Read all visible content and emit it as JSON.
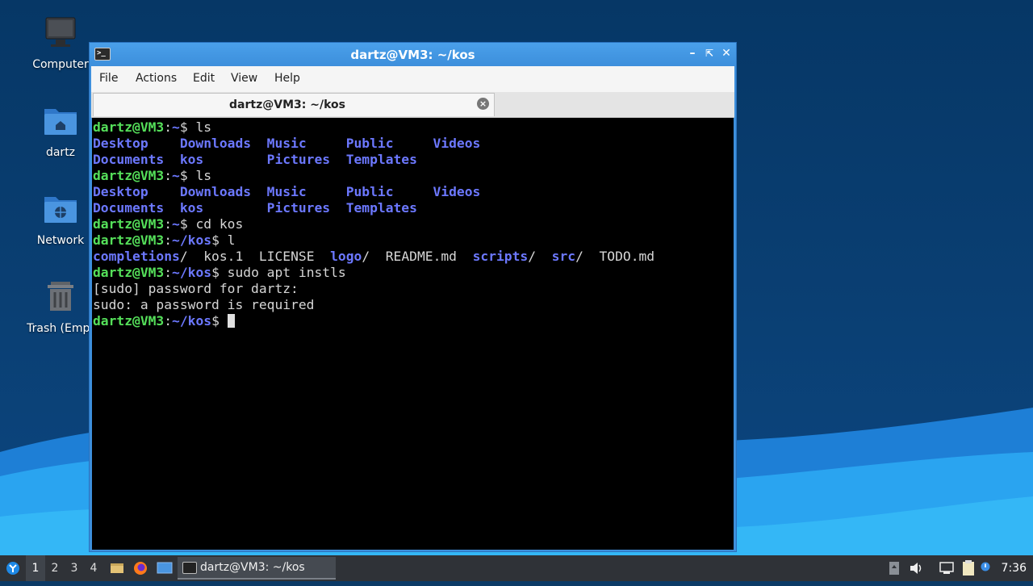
{
  "desktop": {
    "icons": [
      {
        "label": "Computer",
        "icon": "computer-icon"
      },
      {
        "label": "dartz",
        "icon": "home-folder-icon"
      },
      {
        "label": "Network",
        "icon": "network-folder-icon"
      },
      {
        "label": "Trash (Empt",
        "icon": "trash-icon"
      }
    ]
  },
  "window": {
    "title": "dartz@VM3: ~/kos",
    "menu": [
      "File",
      "Actions",
      "Edit",
      "View",
      "Help"
    ],
    "tab_label": "dartz@VM3: ~/kos",
    "controls": [
      "minimize",
      "maximize",
      "close"
    ]
  },
  "terminal": {
    "prompt_user": "dartz@VM3",
    "lines": [
      {
        "prompt": "dartz@VM3",
        "path": "~",
        "cmd": "ls"
      },
      {
        "ls": [
          "Desktop",
          "Downloads",
          "Music",
          "Public",
          "Videos"
        ]
      },
      {
        "ls": [
          "Documents",
          "kos",
          "Pictures",
          "Templates"
        ]
      },
      {
        "prompt": "dartz@VM3",
        "path": "~",
        "cmd": "ls"
      },
      {
        "ls": [
          "Desktop",
          "Downloads",
          "Music",
          "Public",
          "Videos"
        ]
      },
      {
        "ls": [
          "Documents",
          "kos",
          "Pictures",
          "Templates"
        ]
      },
      {
        "prompt": "dartz@VM3",
        "path": "~",
        "cmd": "cd kos"
      },
      {
        "prompt": "dartz@VM3",
        "path": "~/kos",
        "cmd": "l"
      },
      {
        "listing": [
          {
            "name": "completions",
            "dir": true
          },
          {
            "name": "kos.1",
            "dir": false
          },
          {
            "name": "LICENSE",
            "dir": false
          },
          {
            "name": "logo",
            "dir": true
          },
          {
            "name": "README.md",
            "dir": false
          },
          {
            "name": "scripts",
            "dir": true
          },
          {
            "name": "src",
            "dir": true
          },
          {
            "name": "TODO.md",
            "dir": false
          }
        ]
      },
      {
        "prompt": "dartz@VM3",
        "path": "~/kos",
        "cmd": "sudo apt instls"
      },
      {
        "text": "[sudo] password for dartz:"
      },
      {
        "text": "sudo: a password is required"
      },
      {
        "prompt": "dartz@VM3",
        "path": "~/kos",
        "cmd": "",
        "cursor": true
      }
    ]
  },
  "taskbar": {
    "workspaces": [
      "1",
      "2",
      "3",
      "4"
    ],
    "active_workspace": "1",
    "launchers": [
      "files-icon",
      "firefox-icon",
      "desktop-icon"
    ],
    "task_label": "dartz@VM3: ~/kos",
    "tray": [
      "drive-icon",
      "volume-icon",
      "network-icon",
      "clipboard-icon",
      "notification-icon"
    ],
    "clock": "7:36"
  },
  "colors": {
    "prompt": "#55e05a",
    "directory": "#6c78ff",
    "window_border": "#3d8fdc",
    "terminal_bg": "#000000"
  }
}
